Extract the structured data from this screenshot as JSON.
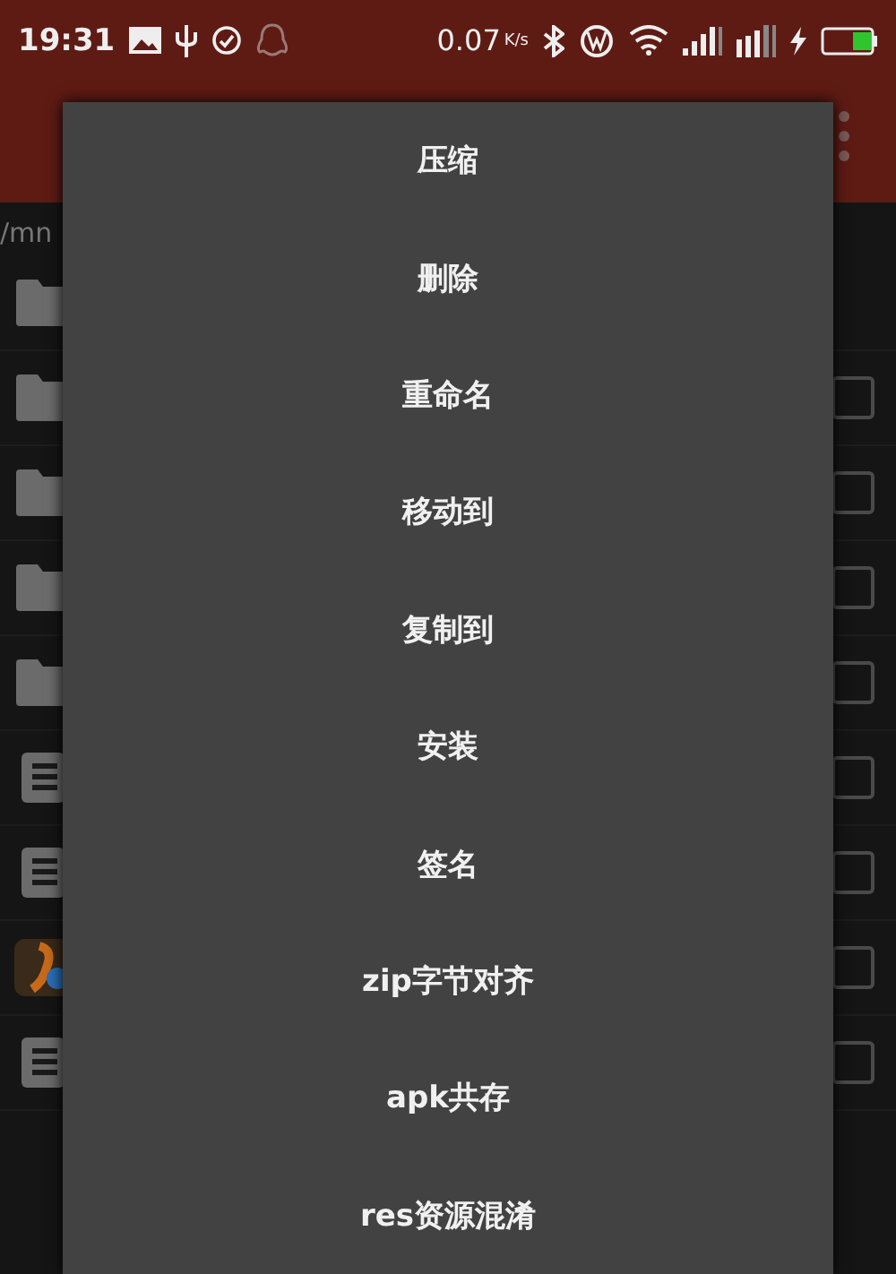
{
  "status_bar": {
    "time": "19:31",
    "speed": "0.07",
    "speed_unit": "K/s"
  },
  "path": "/mn",
  "files": [
    {
      "kind": "folder"
    },
    {
      "kind": "folder",
      "checked": false
    },
    {
      "kind": "folder",
      "checked": false
    },
    {
      "kind": "folder",
      "checked": false
    },
    {
      "kind": "folder",
      "checked": false
    },
    {
      "kind": "file",
      "checked": false
    },
    {
      "kind": "file",
      "checked": false
    },
    {
      "kind": "app",
      "checked": false
    },
    {
      "kind": "file",
      "checked": false
    }
  ],
  "menu": {
    "items": [
      "压缩",
      "删除",
      "重命名",
      "移动到",
      "复制到",
      "安装",
      "签名",
      "zip字节对齐",
      "apk共存",
      "res资源混淆"
    ]
  }
}
